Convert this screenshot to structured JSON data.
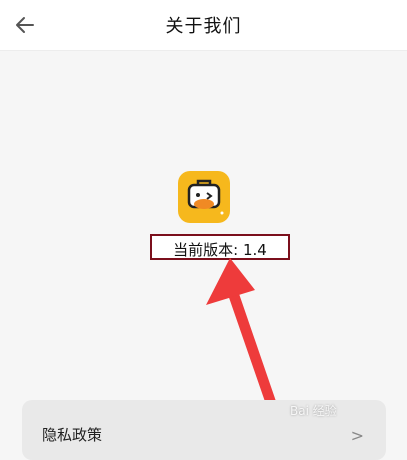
{
  "header": {
    "title": "关于我们",
    "back_icon": "arrow-left-icon"
  },
  "app": {
    "logo_icon": "duck-briefcase-logo",
    "version_text": "当前版本: 1.4"
  },
  "privacy": {
    "label": "隐私政策",
    "chevron": ">"
  },
  "colors": {
    "highlight_border": "#7b0f1c",
    "annotation_arrow": "#ee3b3b",
    "logo_yellow": "#f6b81d"
  }
}
